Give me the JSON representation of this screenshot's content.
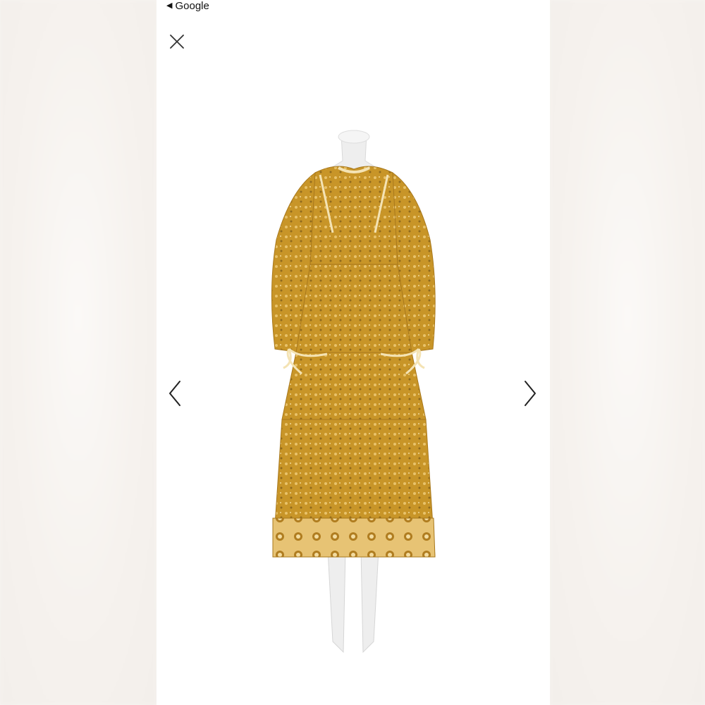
{
  "topbar": {
    "back_label": "Google",
    "back_icon": "back-triangle-icon"
  },
  "viewer": {
    "close_icon": "close-icon",
    "prev_icon": "chevron-left-icon",
    "next_icon": "chevron-right-icon"
  },
  "image": {
    "subject": "mannequin-wearing-tiered-floral-midi-dress"
  },
  "colors": {
    "dress": "#c89528",
    "dress_dark": "#a8781c",
    "trim": "#f4e3b4",
    "mannequin": "#efefef",
    "background": "#ffffff",
    "side": "#f6f2ee"
  }
}
